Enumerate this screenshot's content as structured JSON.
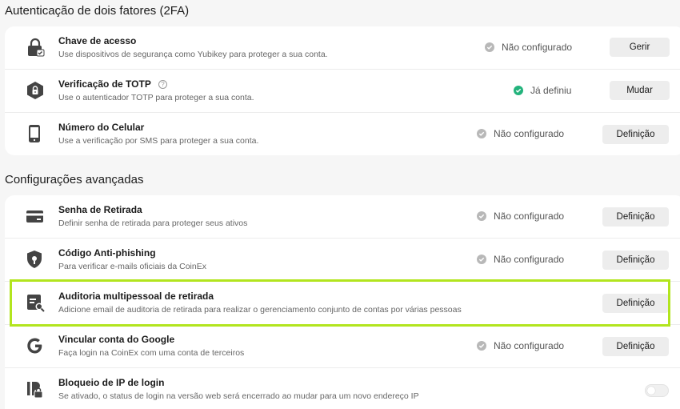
{
  "sections": {
    "twofa": {
      "title": "Autenticação de dois fatores (2FA)"
    },
    "advanced": {
      "title": "Configurações avançadas"
    }
  },
  "colors": {
    "highlight": "#b2e51e",
    "success": "#23b37c",
    "neutral": "#b8b8b8"
  },
  "twofa_rows": [
    {
      "icon": "lock-icon",
      "title": "Chave de acesso",
      "description": "Use dispositivos de segurança como Yubikey para proteger a sua conta.",
      "status": "Não configurado",
      "button": "Gerir"
    },
    {
      "icon": "shield-lock-icon",
      "title": "Verificação de TOTP",
      "help": "?",
      "description": "Use o autenticador TOTP para proteger a sua conta.",
      "status": "Já definiu",
      "button": "Mudar"
    },
    {
      "icon": "phone-icon",
      "title": "Número do Celular",
      "description": "Use a verificação por SMS para proteger a sua conta.",
      "status": "Não configurado",
      "button": "Definição"
    }
  ],
  "advanced_rows": [
    {
      "icon": "card-icon",
      "title": "Senha de Retirada",
      "description": "Definir senha de retirada para proteger seus ativos",
      "status": "Não configurado",
      "button": "Definição"
    },
    {
      "icon": "anti-phishing-shield-icon",
      "title": "Código Anti-phishing",
      "description": "Para verificar e-mails oficiais da CoinEx",
      "status": "Não configurado",
      "button": "Definição"
    },
    {
      "icon": "audit-document-icon",
      "title": "Auditoria multipessoal de retirada",
      "description": "Adicione email de auditoria de retirada para realizar o gerenciamento conjunto de contas por várias pessoas",
      "button": "Definição"
    },
    {
      "icon": "google-icon",
      "title": "Vincular conta do Google",
      "description": "Faça login na CoinEx com uma conta de terceiros",
      "status": "Não configurado",
      "button": "Definição"
    },
    {
      "icon": "ip-lock-icon",
      "title": "Bloqueio de IP de login",
      "description": "Se ativado, o status de login na versão web será encerrado ao mudar para um novo endereço IP",
      "toggle_on": false
    }
  ]
}
